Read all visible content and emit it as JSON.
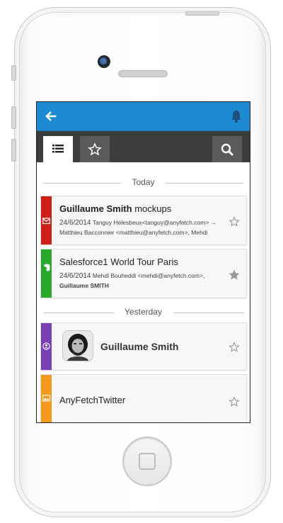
{
  "header": {
    "back_icon": "arrow-left-icon",
    "notifications_icon": "bell-icon",
    "brand_color": "#1e8ad4"
  },
  "toolbar": {
    "list_icon": "list-icon",
    "favorites_icon": "star-outline-icon",
    "search_icon": "search-icon"
  },
  "sections": {
    "today": "Today",
    "yesterday": "Yesterday"
  },
  "items": [
    {
      "type": "email",
      "stripe_color": "#cc1f1a",
      "icon": "envelope-icon",
      "sender": "Guillaume Smith",
      "subject": "mockups",
      "date": "24/6/2014",
      "participants_line1": "Tanguy Hélesbeux<tanguy@anyfetch.com> →",
      "participants_line2": "Matthieu Bacconnier <matthieu@anyfetch.com>, Mehdi",
      "starred": false
    },
    {
      "type": "event",
      "stripe_color": "#2aa82a",
      "icon": "evernote-icon",
      "title": "Salesforce1 World Tour Paris",
      "date": "24/6/2014",
      "participants_line1": "Mehdi Bouheddi <mehdi@anyfetch.com>,",
      "participants_line2": "Guillaume SMITH",
      "starred": true
    },
    {
      "type": "contact",
      "stripe_color": "#7b3fb5",
      "icon": "contact-icon",
      "name": "Guillaume Smith",
      "starred": false
    },
    {
      "type": "image",
      "stripe_color": "#f39a1e",
      "icon": "image-icon",
      "title": "AnyFetchTwitter",
      "starred": false
    }
  ]
}
